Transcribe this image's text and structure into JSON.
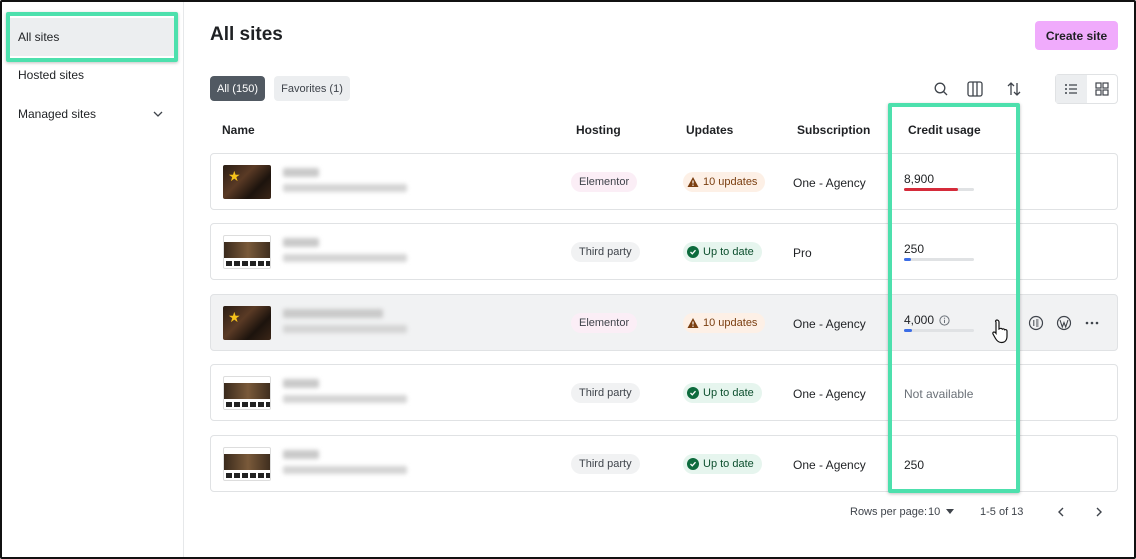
{
  "sidebar": {
    "items": [
      {
        "label": "All sites"
      },
      {
        "label": "Hosted sites"
      },
      {
        "label": "Managed sites"
      }
    ]
  },
  "header": {
    "title": "All sites",
    "create_label": "Create site"
  },
  "filters": {
    "all": "All (150)",
    "favorites": "Favorites (1)"
  },
  "toolbar_icons": [
    "search-icon",
    "columns-icon",
    "sort-icon",
    "list-view-icon",
    "grid-view-icon"
  ],
  "columns": {
    "name": "Name",
    "hosting": "Hosting",
    "updates": "Updates",
    "subscription": "Subscription",
    "credit": "Credit usage"
  },
  "rows": [
    {
      "favorite": true,
      "hosting": "Elementor",
      "updates": "10 updates",
      "updates_status": "warning",
      "subscription": "One - Agency",
      "credit": "8,900",
      "usage_fraction": 0.77,
      "bar_color": "#d52b3a"
    },
    {
      "favorite": false,
      "hosting": "Third party",
      "updates": "Up to date",
      "updates_status": "ok",
      "subscription": "Pro",
      "credit": "250",
      "usage_fraction": 0.1,
      "bar_color": "#3b6de6"
    },
    {
      "favorite": true,
      "hosting": "Elementor",
      "updates": "10 updates",
      "updates_status": "warning",
      "subscription": "One - Agency",
      "credit": "4,000",
      "usage_fraction": 0.12,
      "bar_color": "#3b6de6"
    },
    {
      "favorite": false,
      "hosting": "Third party",
      "updates": "Up to date",
      "updates_status": "ok",
      "subscription": "One - Agency",
      "credit": "Not available"
    },
    {
      "favorite": false,
      "hosting": "Third party",
      "updates": "Up to date",
      "updates_status": "ok",
      "subscription": "One - Agency",
      "credit": "250"
    }
  ],
  "footer": {
    "rows_per_page_label": "Rows per page:",
    "rows_per_page_value": "10",
    "range": "1-5 of 13"
  },
  "colors": {
    "accent_highlight": "#4de0ad",
    "create_button": "#f0abfc",
    "active_filter": "#515962"
  }
}
